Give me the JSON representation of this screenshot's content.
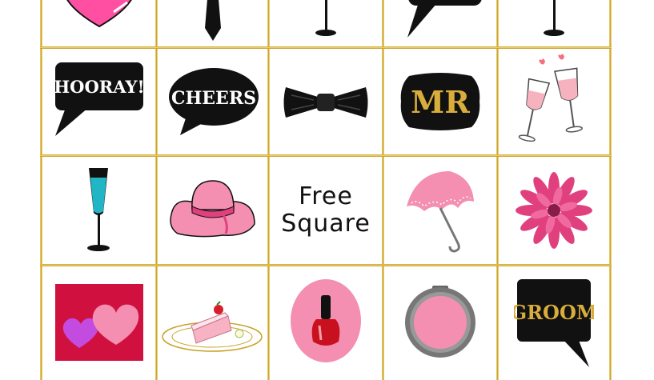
{
  "board": {
    "row0": [
      "heart",
      "necktie",
      "glass",
      "speech-bubble",
      "glass"
    ],
    "row1": [
      "HOORAY!",
      "CHEERS",
      "bow-tie",
      "MR",
      "champagne-toast"
    ],
    "row2": [
      "champagne-flute",
      "sun-hat",
      "Free Square",
      "umbrella",
      "flower"
    ],
    "row3": [
      "hearts-card",
      "cake-slice",
      "nail-polish",
      "compact-mirror",
      "GROOM"
    ]
  },
  "labels": {
    "hooray": "HOORAY!",
    "cheers": "CHEERS",
    "mr": "MR",
    "free_line1": "Free",
    "free_line2": "Square",
    "groom": "GROOM"
  },
  "colors": {
    "gold": "#c9a227",
    "pink": "#f48fb1",
    "hot_pink": "#e91e63",
    "black": "#111111",
    "teal": "#21b5c6",
    "red": "#d61f2c"
  }
}
